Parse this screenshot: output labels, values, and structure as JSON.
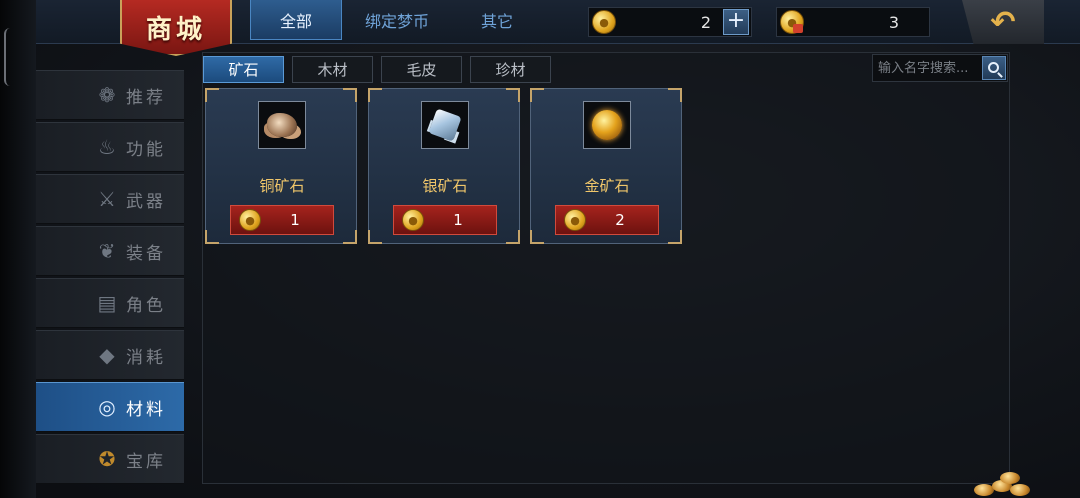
{
  "app": {
    "logo_text": "商城",
    "tabs": [
      "全部",
      "绑定梦币",
      "其它"
    ],
    "currency_bound": {
      "value": "2",
      "plus": "+"
    },
    "currency_locked": {
      "value": "3"
    },
    "back_icon": "back-arrow-icon"
  },
  "sidebar": {
    "items": [
      {
        "label": "推荐",
        "icon": "money-bag-icon",
        "glyph": "❁"
      },
      {
        "label": "功能",
        "icon": "function-icon",
        "glyph": "♨"
      },
      {
        "label": "武器",
        "icon": "crossed-swords-icon",
        "glyph": "⚔"
      },
      {
        "label": "装备",
        "icon": "armor-icon",
        "glyph": "❦"
      },
      {
        "label": "角色",
        "icon": "cards-icon",
        "glyph": "▤"
      },
      {
        "label": "消耗",
        "icon": "scroll-icon",
        "glyph": "◆"
      },
      {
        "label": "材料",
        "icon": "materials-icon",
        "glyph": "◎"
      },
      {
        "label": "宝库",
        "icon": "treasure-icon",
        "glyph": "✪"
      }
    ],
    "active_index": 6
  },
  "subtabs": [
    "矿石",
    "木材",
    "毛皮",
    "珍材"
  ],
  "search": {
    "placeholder": "输入名字搜索..."
  },
  "items": [
    {
      "name": "铜矿石",
      "price": "1",
      "icon": "copper-ore-icon"
    },
    {
      "name": "银矿石",
      "price": "1",
      "icon": "silver-ore-icon"
    },
    {
      "name": "金矿石",
      "price": "2",
      "icon": "gold-ore-icon"
    }
  ],
  "colors": {
    "accent": "#2d6aa8",
    "price_bg": "#a5231d",
    "item_name": "#f0c66a",
    "logo_red": "#b52a22"
  }
}
